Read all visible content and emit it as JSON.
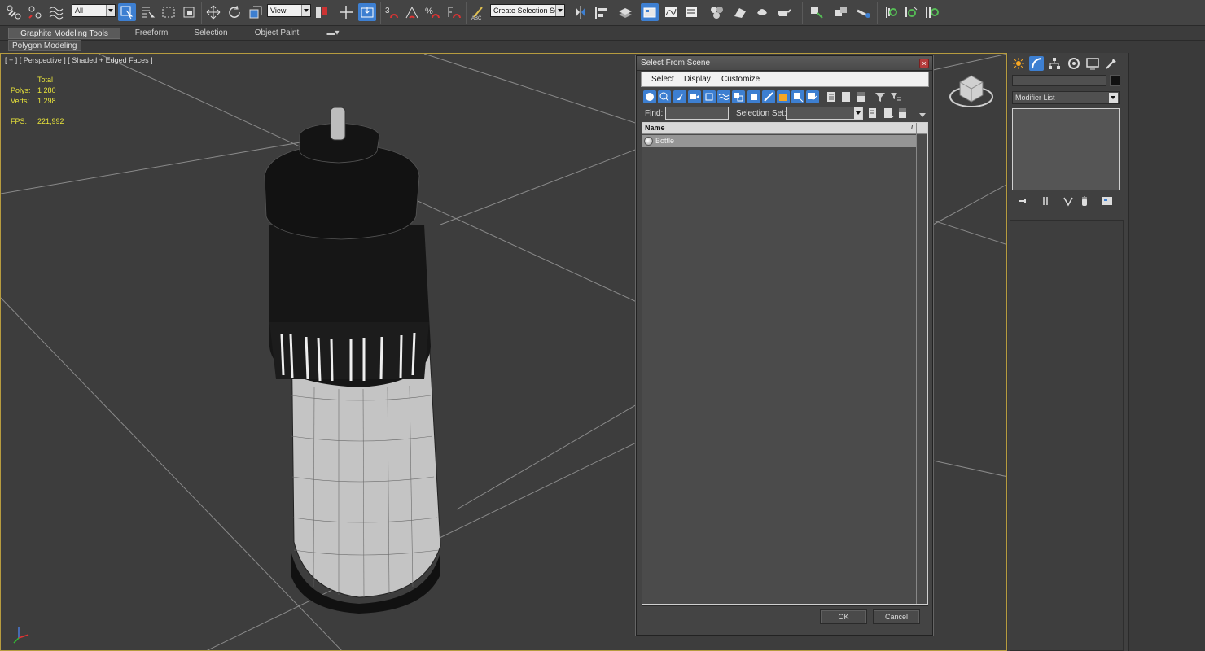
{
  "toolbar": {
    "filter_select": "All",
    "refcoord_select": "View",
    "snap_label_3": "3",
    "named_selection_placeholder": "Create Selection Se",
    "accent_color": "#3d7fd1"
  },
  "ribbon": {
    "tabs": [
      "Graphite Modeling Tools",
      "Freeform",
      "Selection",
      "Object Paint"
    ],
    "active_tab": "Graphite Modeling Tools",
    "panel_label": "Polygon Modeling"
  },
  "viewport": {
    "label": "[ + ] [ Perspective ] [ Shaded + Edged Faces ]",
    "stats": {
      "total_label": "Total",
      "polys_label": "Polys:",
      "polys_value": "1 280",
      "verts_label": "Verts:",
      "verts_value": "1 298",
      "fps_label": "FPS:",
      "fps_value": "221,992"
    },
    "border_color": "#b79c3f"
  },
  "command_panel": {
    "modifier_list": "Modifier List"
  },
  "dialog": {
    "title": "Select From Scene",
    "close_glyph": "×",
    "menu": [
      "Select",
      "Display",
      "Customize"
    ],
    "find_label": "Find:",
    "selection_set_label": "Selection Set:",
    "column_name": "Name",
    "sort_glyph": "/",
    "objects": [
      {
        "name": "Bottle",
        "selected": true
      }
    ],
    "ok_label": "OK",
    "cancel_label": "Cancel"
  }
}
